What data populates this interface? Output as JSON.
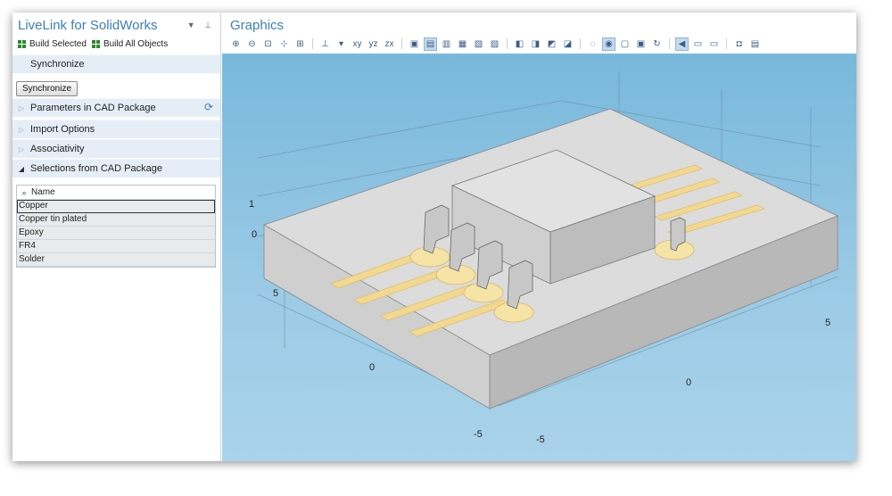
{
  "left_panel": {
    "title": "LiveLink for SolidWorks",
    "build_selected": "Build Selected",
    "build_all": "Build All Objects",
    "sync_section": "Synchronize",
    "sync_button": "Synchronize",
    "sections": [
      {
        "label": "Parameters in CAD Package",
        "arrow": "▷"
      },
      {
        "label": "Import Options",
        "arrow": "▷"
      },
      {
        "label": "Associativity",
        "arrow": "▷"
      },
      {
        "label": "Selections from CAD Package",
        "arrow": "◢"
      }
    ],
    "table": {
      "header_icon": "»",
      "header": "Name",
      "rows": [
        "Copper",
        "Copper tin plated",
        "Epoxy",
        "FR4",
        "Solder"
      ]
    }
  },
  "graphics": {
    "title": "Graphics",
    "axis_labels": {
      "left_1": "1",
      "left_0": "0",
      "left_5": "5",
      "front_0": "0",
      "right_5": "5",
      "right_0": "0",
      "bottom_m5_a": "-5",
      "bottom_m5_b": "-5"
    }
  },
  "toolbar_icons": [
    "zoom-in",
    "zoom-out",
    "zoom-box",
    "zoom-selected",
    "zoom-extents",
    "axes",
    "xy-view",
    "yz-view",
    "zx-view",
    "render-1",
    "render-2",
    "render-3",
    "render-4",
    "render-5",
    "render-6",
    "select-1",
    "select-2",
    "select-3",
    "select-4",
    "hide",
    "show",
    "transparency",
    "reset",
    "view-1",
    "view-2",
    "view-3",
    "camera",
    "print"
  ],
  "colors": {
    "accent": "#3c7fb8",
    "viewport_top": "#78b8db",
    "board": "#d8d8d8",
    "trace": "#f3d98f",
    "section_bg": "#e5eef7"
  }
}
